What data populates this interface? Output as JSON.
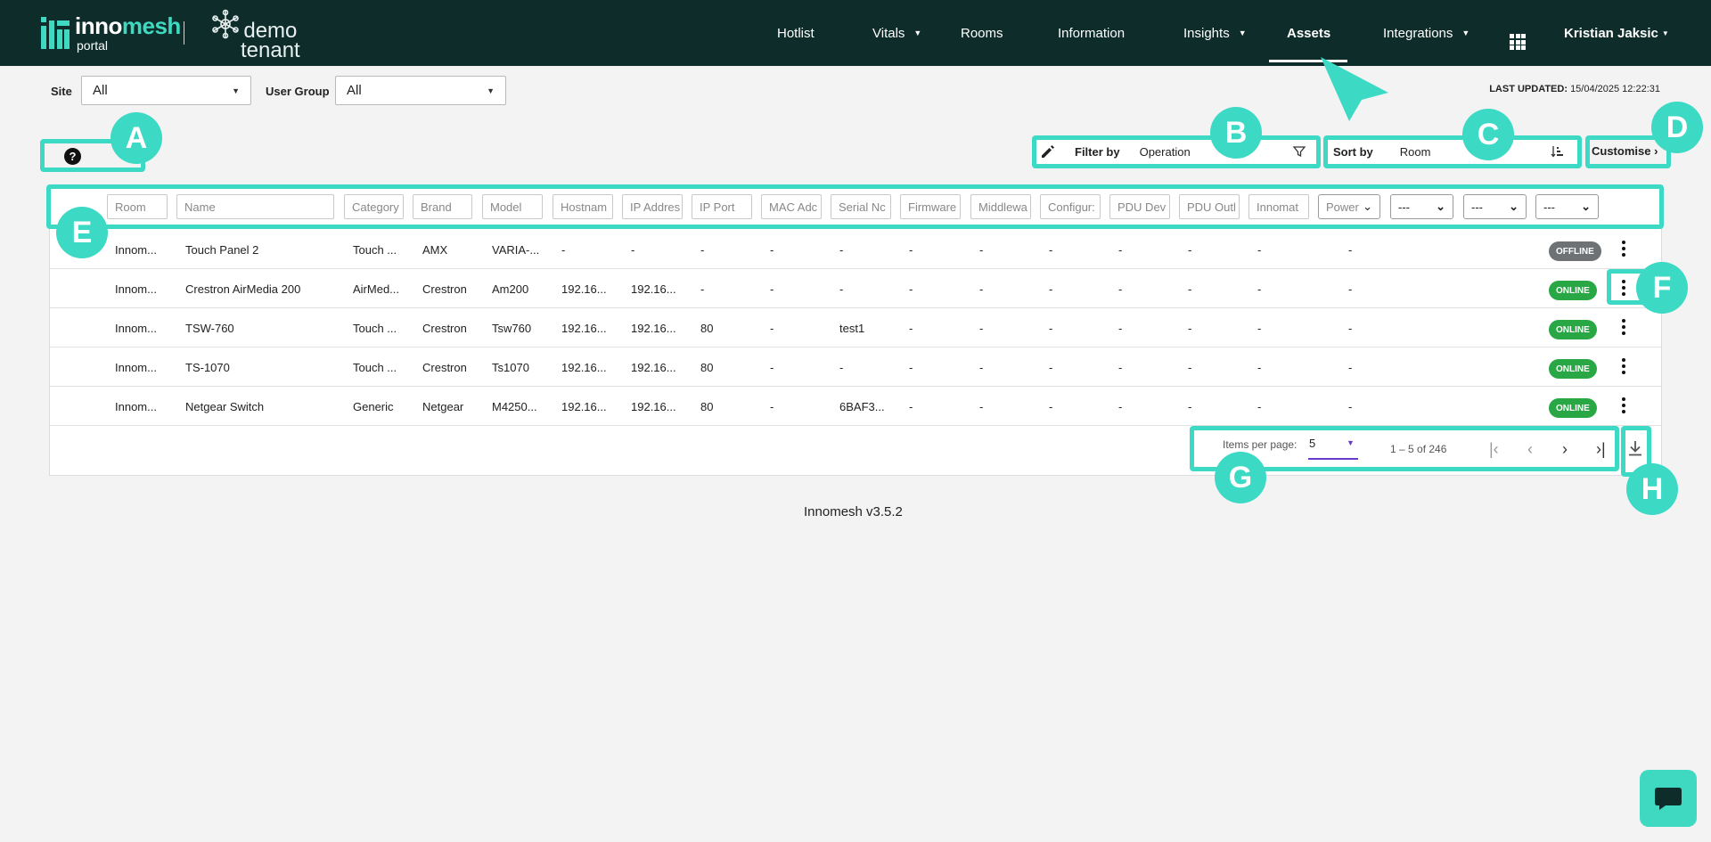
{
  "header": {
    "logo_brand_a": "inno",
    "logo_brand_b": "mesh",
    "logo_sub": "portal",
    "tenant_line1": "demo",
    "tenant_line2": "tenant",
    "nav": [
      {
        "label": "Hotlist"
      },
      {
        "label": "Vitals"
      },
      {
        "label": "Rooms"
      },
      {
        "label": "Information"
      },
      {
        "label": "Insights"
      },
      {
        "label": "Assets"
      },
      {
        "label": "Integrations"
      }
    ],
    "user_name": "Kristian Jaksic"
  },
  "filters": {
    "site_label": "Site",
    "site_value": "All",
    "usergroup_label": "User Group",
    "usergroup_value": "All",
    "last_updated_label": "LAST UPDATED:",
    "last_updated_value": "15/04/2025 12:22:31"
  },
  "toolbar": {
    "filter_label": "Filter by",
    "filter_value": "Operation",
    "sort_label": "Sort by",
    "sort_value": "Room",
    "customise_label": "Customise"
  },
  "columns": [
    {
      "placeholder": "Room"
    },
    {
      "placeholder": "Name"
    },
    {
      "placeholder": "Category"
    },
    {
      "placeholder": "Brand"
    },
    {
      "placeholder": "Model"
    },
    {
      "placeholder": "Hostnam"
    },
    {
      "placeholder": "IP Addres"
    },
    {
      "placeholder": "IP Port"
    },
    {
      "placeholder": "MAC Adc"
    },
    {
      "placeholder": "Serial Nc"
    },
    {
      "placeholder": "Firmware"
    },
    {
      "placeholder": "Middlewa"
    },
    {
      "placeholder": "Configur:"
    },
    {
      "placeholder": "PDU Dev"
    },
    {
      "placeholder": "PDU Outl"
    },
    {
      "placeholder": "Innomat"
    },
    {
      "placeholder": "Power"
    }
  ],
  "column_selects": [
    "---",
    "---",
    "---"
  ],
  "rows": [
    {
      "cells": [
        "Innom...",
        "Touch Panel 2",
        "Touch ...",
        "AMX",
        "VARIA-...",
        "-",
        "-",
        "-",
        "-",
        "-",
        "-",
        "-",
        "-",
        "-",
        "-",
        "-",
        "-"
      ],
      "status": "OFFLINE"
    },
    {
      "cells": [
        "Innom...",
        "Crestron AirMedia 200",
        "AirMed...",
        "Crestron",
        "Am200",
        "192.16...",
        "192.16...",
        "-",
        "-",
        "-",
        "-",
        "-",
        "-",
        "-",
        "-",
        "-",
        "-"
      ],
      "status": "ONLINE"
    },
    {
      "cells": [
        "Innom...",
        "TSW-760",
        "Touch ...",
        "Crestron",
        "Tsw760",
        "192.16...",
        "192.16...",
        "80",
        "-",
        "test1",
        "-",
        "-",
        "-",
        "-",
        "-",
        "-",
        "-"
      ],
      "status": "ONLINE"
    },
    {
      "cells": [
        "Innom...",
        "TS-1070",
        "Touch ...",
        "Crestron",
        "Ts1070",
        "192.16...",
        "192.16...",
        "80",
        "-",
        "-",
        "-",
        "-",
        "-",
        "-",
        "-",
        "-",
        "-"
      ],
      "status": "ONLINE"
    },
    {
      "cells": [
        "Innom...",
        "Netgear Switch",
        "Generic",
        "Netgear",
        "M4250...",
        "192.16...",
        "192.16...",
        "80",
        "-",
        "6BAF3...",
        "-",
        "-",
        "-",
        "-",
        "-",
        "-",
        "-"
      ],
      "status": "ONLINE"
    }
  ],
  "pagination": {
    "items_per_page_label": "Items per page:",
    "items_per_page_value": "5",
    "range_text": "1 – 5 of 246"
  },
  "footer": {
    "version": "Innomesh v3.5.2"
  },
  "annotations": [
    "A",
    "B",
    "C",
    "D",
    "E",
    "F",
    "G",
    "H"
  ],
  "colors": {
    "header_bg": "#0d2c2a",
    "accent": "#3cd9c4",
    "online": "#2aa745",
    "offline": "#6e7275"
  }
}
